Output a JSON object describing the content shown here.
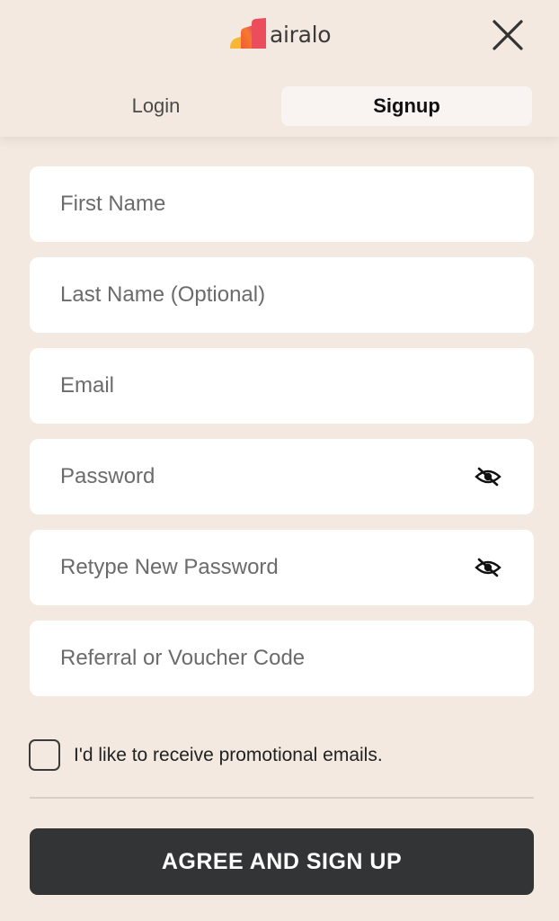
{
  "brand": {
    "name": "airalo"
  },
  "header": {
    "close_icon": "close-icon"
  },
  "tabs": [
    {
      "label": "Login",
      "active": false
    },
    {
      "label": "Signup",
      "active": true
    }
  ],
  "form": {
    "first_name": {
      "placeholder": "First Name",
      "value": ""
    },
    "last_name": {
      "placeholder": "Last Name (Optional)",
      "value": ""
    },
    "email": {
      "placeholder": "Email",
      "value": ""
    },
    "password": {
      "placeholder": "Password",
      "value": "",
      "icon": "eye-slash-icon"
    },
    "retype_password": {
      "placeholder": "Retype New Password",
      "value": "",
      "icon": "eye-slash-icon"
    },
    "referral": {
      "placeholder": "Referral or Voucher Code",
      "value": ""
    }
  },
  "promo": {
    "label": "I'd like to receive promotional emails.",
    "checked": false
  },
  "submit": {
    "label": "AGREE AND SIGN UP"
  },
  "colors": {
    "background": "#f3e9e0",
    "button": "#333435",
    "logo_gradient": [
      "#f15a3a",
      "#f7b733"
    ]
  }
}
